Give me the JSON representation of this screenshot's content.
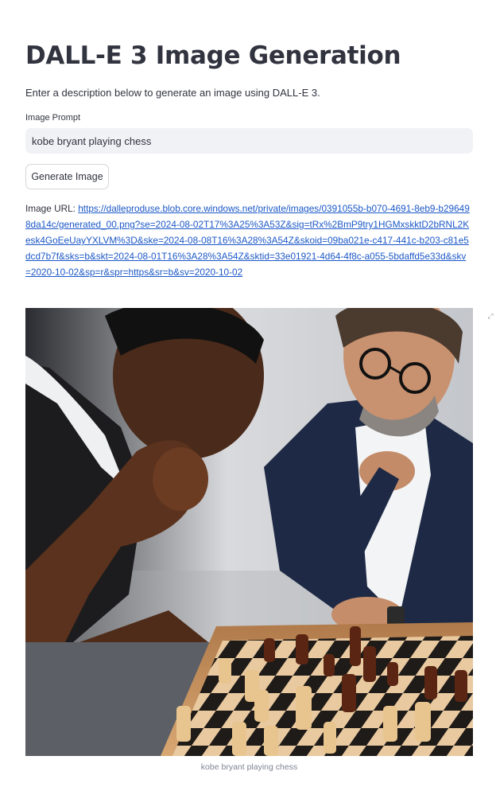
{
  "header": {
    "title": "DALL-E 3 Image Generation",
    "subtitle": "Enter a description below to generate an image using DALL-E 3."
  },
  "form": {
    "prompt_label": "Image Prompt",
    "prompt_value": "kobe bryant playing chess",
    "button_label": "Generate Image"
  },
  "result": {
    "url_label": "Image URL:",
    "url": "https://dalleproduse.blob.core.windows.net/private/images/0391055b-b070-4691-8eb9-b296498da14c/generated_00.png?se=2024-08-02T17%3A25%3A53Z&sig=tRx%2BmP9try1HGMxskktD2bRNL2Kesk4GoEeUayYXLVM%3D&ske=2024-08-08T16%3A28%3A54Z&skoid=09ba021e-c417-441c-b203-c81e5dcd7b7f&sks=b&skt=2024-08-01T16%3A28%3A54Z&sktid=33e01921-4d64-4f8c-a055-5bdaffd5e33d&skv=2020-10-02&sp=r&spr=https&sr=b&sv=2020-10-02",
    "image_caption": "kobe bryant playing chess"
  },
  "icons": {
    "fullscreen": "fullscreen-expand-icon"
  },
  "colors": {
    "link": "#1c58c7",
    "input_bg": "#f0f2f6",
    "text": "#31333f",
    "caption": "#808495"
  }
}
